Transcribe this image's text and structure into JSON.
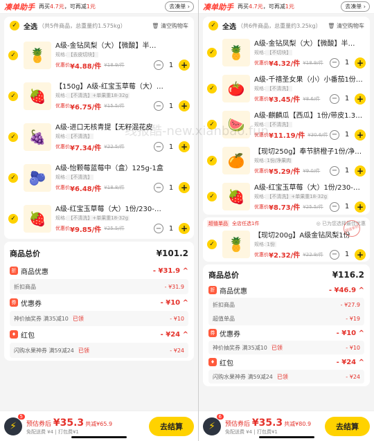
{
  "left": {
    "topbar": {
      "logo": "凑单助手",
      "msg_a": "再买",
      "msg_b": "4.7元",
      "msg_c": "，可再减",
      "msg_d": "1元",
      "button": "去凑单 ›"
    },
    "select_all": {
      "label": "全选",
      "sub": "（共5件商品，总重量约1.575kg）",
      "clear": "清空购物车"
    },
    "items": [
      {
        "thumb": "🍍",
        "name": "A级-金钻凤梨（大）【微酸】半…",
        "spec": "规格:",
        "spec_tag": "【去皮切块】",
        "plabel": "优惠价",
        "price": "¥4.88/件",
        "oprice": "¥18.9/件",
        "qty": "1"
      },
      {
        "thumb": "🍓",
        "name": "【150g】A级-红宝玉草莓（大）…",
        "spec": "规格:",
        "spec_tag": "【不清洗】+单果重18-32g",
        "plabel": "优惠价",
        "price": "¥6.75/件",
        "oprice": "¥15.5/件",
        "qty": "1"
      },
      {
        "thumb": "🍇",
        "name": "A级-进口无核青提【无籽混花皮",
        "spec": "规格:",
        "spec_tag": "【不清洗】",
        "plabel": "优惠价",
        "price": "¥7.34/件",
        "oprice": "¥22.5/件",
        "qty": "1"
      },
      {
        "thumb": "🫐",
        "name": "A级-怡颗莓蓝莓中（盒）125g-1盒",
        "spec": "规格:",
        "spec_tag": "【不清洗】",
        "plabel": "优惠价",
        "price": "¥6.48/件",
        "oprice": "¥18.8/件",
        "qty": "1"
      },
      {
        "thumb": "🍓",
        "name": "A级-红宝玉草莓（大）1份/230-…",
        "spec": "规格:",
        "spec_tag": "【不清洗】+单果重18-32g",
        "plabel": "优惠价",
        "price": "¥9.85/件",
        "oprice": "¥25.5/件",
        "qty": "1"
      }
    ],
    "summary": {
      "total_label": "商品总价",
      "total": "¥101.2",
      "disc_label": "商品优惠",
      "disc": "- ¥31.9 ^",
      "disc_sub": "折扣商品",
      "disc_sub_amt": "- ¥31.9",
      "coupon_label": "优惠券",
      "coupon": "- ¥10 ^",
      "coupon_sub": "神价抽奖券  满35减10",
      "coupon_used": "已领",
      "coupon_sub_amt": "- ¥10",
      "red_label": "红包",
      "red": "- ¥24 ^",
      "red_sub": "闪购水果神券  满59减24",
      "red_used": "已领",
      "red_sub_amt": "- ¥24"
    },
    "bottom": {
      "count": "5",
      "est_label": "预估券后",
      "est": "¥35.3",
      "cut": "共减¥65.9",
      "delivery": "免配送费 ¥4 | 打包费¥1",
      "checkout": "去结算"
    }
  },
  "right": {
    "topbar": {
      "logo": "凑单助手",
      "msg_a": "再买",
      "msg_b": "4.7元",
      "msg_c": "，可再减",
      "msg_d": "1元",
      "button": "去凑单 ›"
    },
    "select_all": {
      "label": "全选",
      "sub": "（共6件商品，总重量约3.25kg）",
      "clear": "清空购物车"
    },
    "items": [
      {
        "thumb": "🍍",
        "name": "A级-金钻凤梨（大）【微酸】半…",
        "spec": "规格:",
        "spec_tag": "【不切块】",
        "plabel": "优惠价",
        "price": "¥4.32/件",
        "oprice": "¥18.9/件",
        "qty": "1"
      },
      {
        "thumb": "🍅",
        "name": "A级-千禧圣女果（小）小番茄1份…",
        "spec": "规格:",
        "spec_tag": "【不清洗】",
        "plabel": "优惠价",
        "price": "¥3.45/件",
        "oprice": "¥8.6/件",
        "qty": "1"
      },
      {
        "thumb": "🍉",
        "name": "A级-麒麟瓜【西瓜】1份/带皮1.3…",
        "spec": "规格:",
        "spec_tag": "【不清洗】",
        "plabel": "优惠价",
        "price": "¥11.19/件",
        "oprice": "¥30.6/件",
        "qty": "1"
      },
      {
        "thumb": "🍊",
        "name": "【现切250g】奉节脐橙子1份/净…",
        "spec": "规格:",
        "spec_tag": "1份/净果肉",
        "plabel": "优惠价",
        "price": "¥5.29/件",
        "oprice": "¥9.0/件",
        "qty": "1"
      },
      {
        "thumb": "🍓",
        "name": "A级-红宝玉草莓（大）1份/230-…",
        "spec": "规格:",
        "spec_tag": "【不清洗】+单果重18-32g",
        "plabel": "优惠价",
        "price": "¥8.73/件",
        "oprice": "¥25.5/件",
        "qty": "1"
      }
    ],
    "promo": {
      "tag": "超值单品",
      "link": "全店任选1件",
      "note": "◎ 已为您选择最佳优惠",
      "stamp": "超值享购"
    },
    "promo_item": {
      "thumb": "🍍",
      "name": "【现切200g】A级金钻凤梨1份",
      "spec": "规格:",
      "spec_tag": "1份",
      "plabel": "优惠价",
      "price": "¥2.32/件",
      "oprice": "¥22.9/件",
      "qty": "1"
    },
    "summary": {
      "total_label": "商品总价",
      "total": "¥116.2",
      "disc_label": "商品优惠",
      "disc": "- ¥46.9 ^",
      "disc_sub": "折扣商品",
      "disc_sub_amt": "- ¥27.9",
      "disc_sub2": "超值单品",
      "disc_sub2_amt": "- ¥19",
      "coupon_label": "优惠券",
      "coupon": "- ¥10 ^",
      "coupon_sub": "神价抽奖券  满35减10",
      "coupon_used": "已领",
      "coupon_sub_amt": "- ¥10",
      "red_label": "红包",
      "red": "- ¥24 ^",
      "red_sub": "闪购水果神券  满59减24",
      "red_used": "已领",
      "red_sub_amt": "- ¥24"
    },
    "bottom": {
      "count": "6",
      "est_label": "预估券后",
      "est": "¥35.3",
      "cut": "共减¥80.9",
      "delivery": "免配送费 ¥4 | 打包费¥1",
      "checkout": "去结算"
    }
  },
  "watermark": "线报酷-new.xianbao.fun"
}
